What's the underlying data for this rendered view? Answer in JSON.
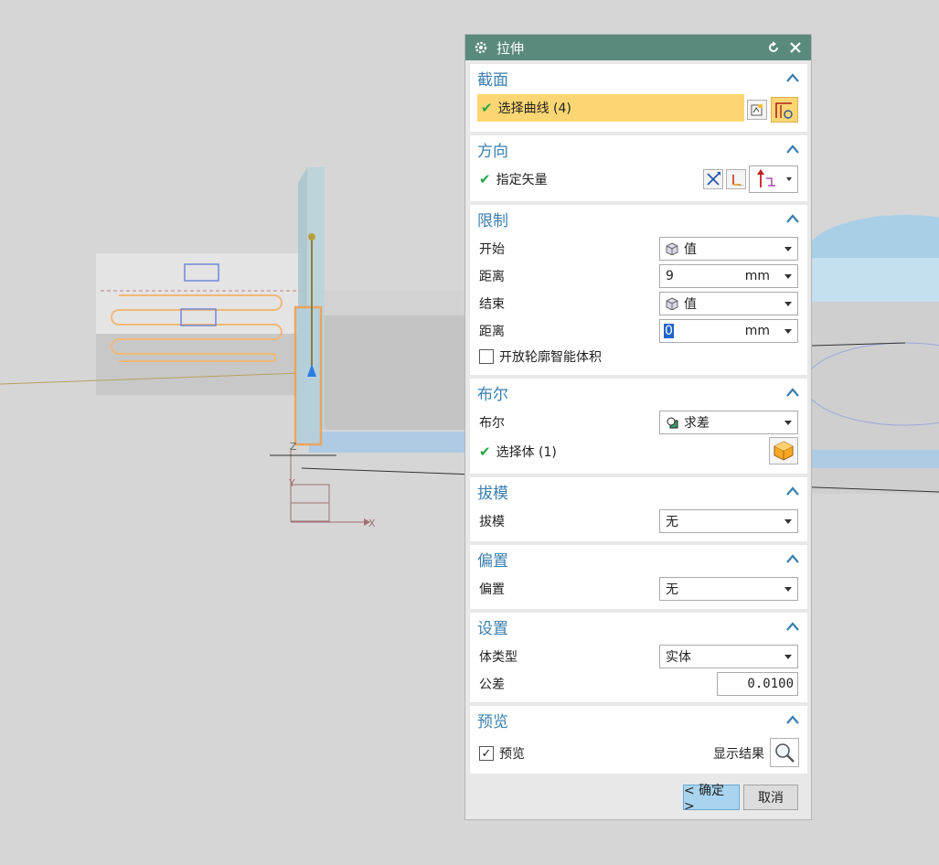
{
  "dialog": {
    "title": "拉伸",
    "sections": {
      "section": {
        "header": "截面",
        "select_curve_label": "选择曲线 (4)"
      },
      "direction": {
        "header": "方向",
        "specify_vector_label": "指定矢量"
      },
      "limits": {
        "header": "限制",
        "start_label": "开始",
        "start_value": "值",
        "distance1_label": "距离",
        "distance1_value": "9",
        "distance1_unit": "mm",
        "end_label": "结束",
        "end_value": "值",
        "distance2_label": "距离",
        "distance2_value": "0",
        "distance2_unit": "mm",
        "open_profile_label": "开放轮廓智能体积"
      },
      "boolean": {
        "header": "布尔",
        "boolean_label": "布尔",
        "boolean_value": "求差",
        "select_body_label": "选择体 (1)"
      },
      "draft": {
        "header": "拔模",
        "draft_label": "拔模",
        "draft_value": "无"
      },
      "offset": {
        "header": "偏置",
        "offset_label": "偏置",
        "offset_value": "无"
      },
      "settings": {
        "header": "设置",
        "body_type_label": "体类型",
        "body_type_value": "实体",
        "tolerance_label": "公差",
        "tolerance_value": "0.0100"
      },
      "preview": {
        "header": "预览",
        "preview_label": "预览",
        "show_result_label": "显示结果"
      }
    },
    "ok_label": "< 确定 >",
    "cancel_label": "取消"
  },
  "viewport": {
    "axis_z": "Z",
    "axis_y": "Y",
    "axis_x": "X"
  },
  "colors": {
    "titlebar": "#5a8a7c",
    "section_header": "#3a7fb0",
    "selected_row": "#fcd672",
    "ok_button": "#a9d4ef",
    "check_green": "#27a844"
  }
}
